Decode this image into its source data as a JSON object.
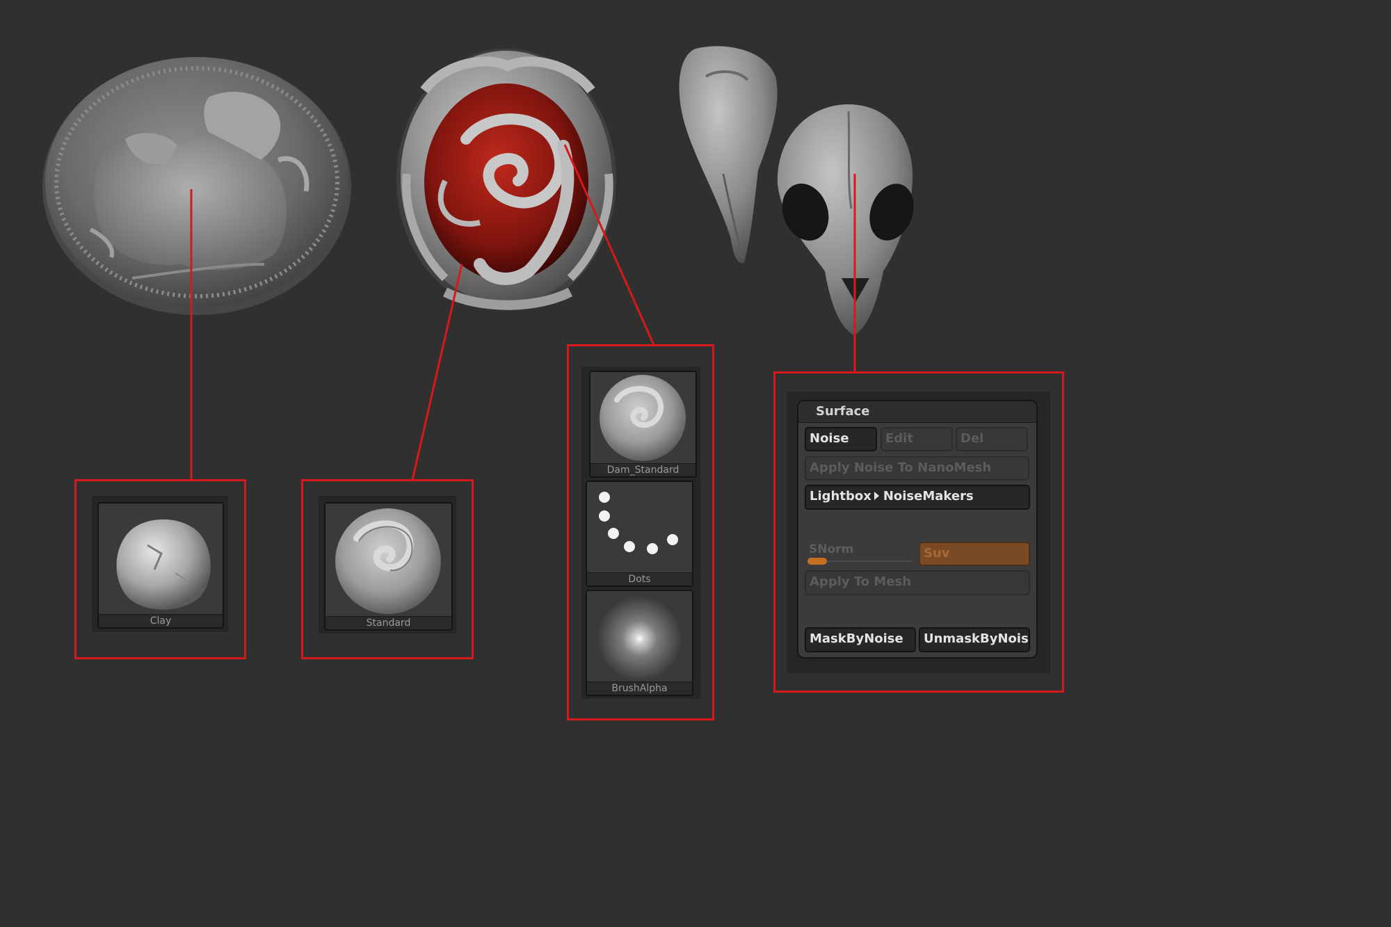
{
  "colors": {
    "background": "#303030",
    "callout_red": "#d6191b",
    "slider_orange": "#c46f22",
    "suv_bg": "#7a4a24"
  },
  "brushes": {
    "clay": "Clay",
    "standard": "Standard",
    "dam_standard": "Dam_Standard",
    "dots": "Dots",
    "brush_alpha": "BrushAlpha"
  },
  "surface_panel": {
    "title": "Surface",
    "noise": "Noise",
    "edit": "Edit",
    "del": "Del",
    "apply_nanomesh": "Apply  Noise  To  NanoMesh",
    "lightbox_prefix": "Lightbox",
    "lightbox_target": "NoiseMakers",
    "snorm": "SNorm",
    "suv": "Suv",
    "apply_mesh": "Apply  To  Mesh",
    "mask_by_noise": "MaskByNoise",
    "unmask_by_noise": "UnmaskByNois"
  }
}
